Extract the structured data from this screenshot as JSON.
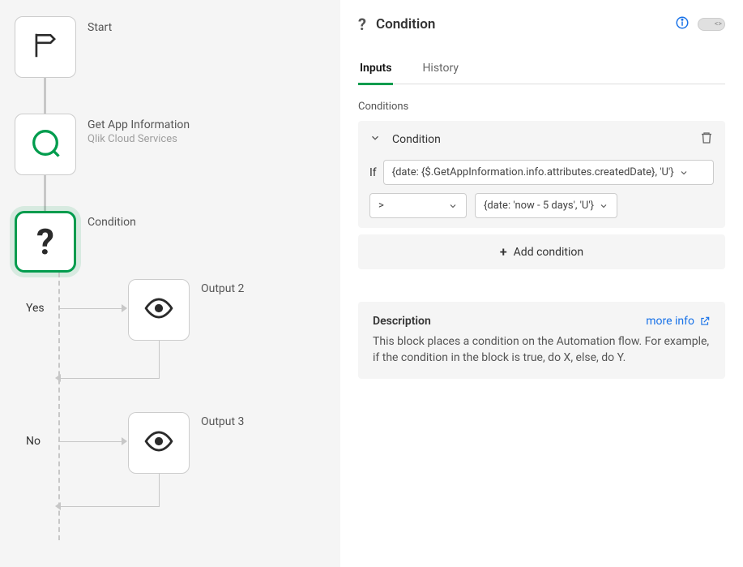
{
  "canvas": {
    "nodes": {
      "start": {
        "title": "Start"
      },
      "getapp": {
        "title": "Get App Information",
        "subtitle": "Qlik Cloud Services"
      },
      "condition": {
        "title": "Condition"
      }
    },
    "branches": {
      "yes_label": "Yes",
      "no_label": "No",
      "output2": "Output 2",
      "output3": "Output 3"
    }
  },
  "panel": {
    "title": "Condition",
    "tabs": {
      "inputs": "Inputs",
      "history": "History"
    },
    "conditions_label": "Conditions",
    "cond_header": "Condition",
    "if_label": "If",
    "left_expr": "{date: {$.GetAppInformation.info.attributes.createdDate}, 'U'}",
    "operator": ">",
    "right_expr": "{date: 'now - 5 days', 'U'}",
    "add_condition": "Add condition",
    "description": {
      "title": "Description",
      "more": "more info",
      "text": "This block places a condition on the Automation flow. For example, if the condition in the block is true, do X, else, do Y."
    }
  }
}
